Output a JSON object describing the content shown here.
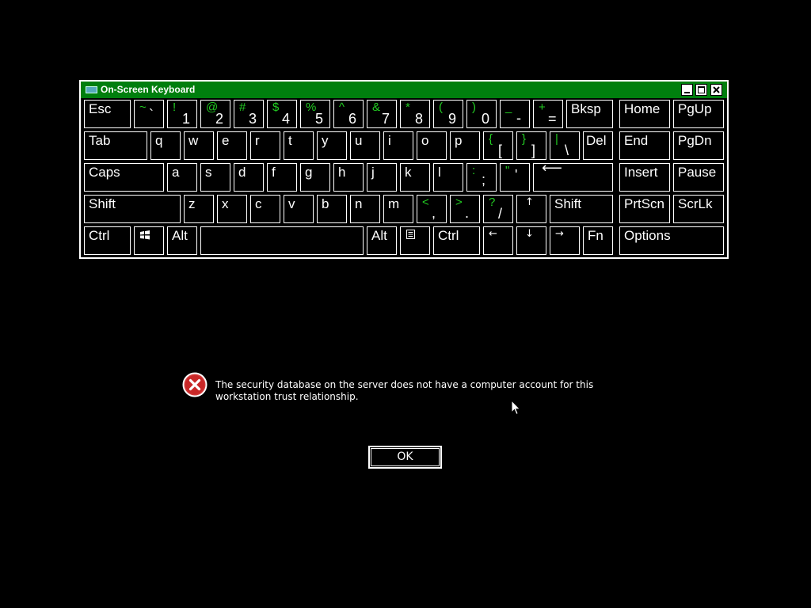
{
  "osk": {
    "title": "On-Screen Keyboard",
    "title_icon": "keyboard-icon",
    "window_buttons": [
      "minimize",
      "maximize",
      "close"
    ],
    "accent_color": "#007f0e",
    "shift_color": "#22cc22",
    "keys": {
      "esc": "Esc",
      "tilde_up": "~",
      "tilde_lo": "`",
      "k1_up": "!",
      "k1": "1",
      "k2_up": "@",
      "k2": "2",
      "k3_up": "#",
      "k3": "3",
      "k4_up": "$",
      "k4": "4",
      "k5_up": "%",
      "k5": "5",
      "k6_up": "^",
      "k6": "6",
      "k7_up": "&",
      "k7": "7",
      "k8_up": "*",
      "k8": "8",
      "k9_up": "(",
      "k9": "9",
      "k0_up": ")",
      "k0": "0",
      "minus_up": "_",
      "minus": "-",
      "equal_up": "+",
      "equal": "=",
      "bksp": "Bksp",
      "home": "Home",
      "pgup": "PgUp",
      "tab": "Tab",
      "q": "q",
      "w": "w",
      "e": "e",
      "r": "r",
      "t": "t",
      "y": "y",
      "u": "u",
      "i": "i",
      "o": "o",
      "p": "p",
      "lbr_up": "{",
      "lbr": "[",
      "rbr_up": "}",
      "rbr": "]",
      "bsl_up": "|",
      "bsl": "\\",
      "del": "Del",
      "end": "End",
      "pgdn": "PgDn",
      "caps": "Caps",
      "a": "a",
      "s": "s",
      "d": "d",
      "f": "f",
      "g": "g",
      "h": "h",
      "j": "j",
      "k": "k",
      "l": "l",
      "semi_up": ":",
      "semi": ";",
      "quote_up": "\"",
      "quote": "'",
      "enter": "⟵",
      "insert": "Insert",
      "pause": "Pause",
      "lshift": "Shift",
      "z": "z",
      "x": "x",
      "c": "c",
      "v": "v",
      "b": "b",
      "n": "n",
      "m": "m",
      "comma_up": "<",
      "comma": ",",
      "period_up": ">",
      "period": ".",
      "slash_up": "?",
      "slash": "/",
      "uparrow": "↑",
      "rshift": "Shift",
      "prtscn": "PrtScn",
      "scrlk": "ScrLk",
      "lctrl": "Ctrl",
      "lalt": "Alt",
      "ralt": "Alt",
      "rctrl": "Ctrl",
      "leftarrow": "←",
      "downarrow": "↓",
      "rightarrow": "→",
      "fn": "Fn",
      "options": "Options"
    }
  },
  "error": {
    "message": "The security database on the server does not have a computer account for this workstation trust relationship.",
    "icon": "error-icon",
    "ok_label": "OK"
  }
}
